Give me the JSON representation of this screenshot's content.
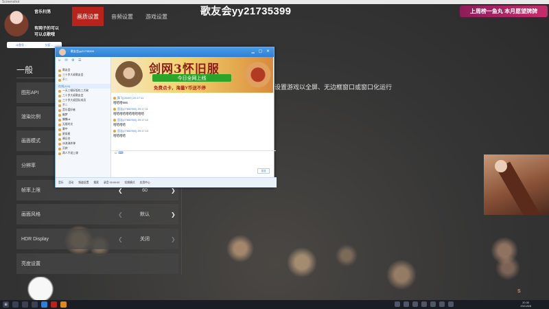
{
  "window": {
    "caption": "Screenshot"
  },
  "streamer": {
    "line1": "音乐扫荡",
    "line2": "有网子的可以",
    "line3": "可以点歌哦",
    "bar_left": "斗鱼号 ...",
    "bar_right": "分区..."
  },
  "tabs": [
    "画质设置",
    "音频设置",
    "游戏设置"
  ],
  "stream_title": "歌友会yy21735399",
  "banner": "上周榜一鱼丸 本月愿望牌牌",
  "section_title": "一般",
  "display_mode_desc": "设置游戏以全屏、无边框窗口或窗口化运行",
  "settings": [
    {
      "label": "图形API",
      "value": ""
    },
    {
      "label": "渲染比例",
      "value": ""
    },
    {
      "label": "画面模式",
      "value": ""
    },
    {
      "label": "分辨率",
      "value": ""
    },
    {
      "label": "帧率上限",
      "value": "60"
    },
    {
      "label": "画面风格",
      "value": "默认"
    },
    {
      "label": "HDR Display",
      "value": "关闭"
    },
    {
      "label": "亮度设置",
      "value": ""
    }
  ],
  "chat": {
    "title": "歌友会yy21735399",
    "sidebar": {
      "icons": "☺ ✉ ⚙ ☰",
      "top_items": [
        "歌友会",
        "三十岁大叔歌友会",
        "不二"
      ],
      "group_header": "在线(124)",
      "members": [
        "一天三顿好饭吃三大碗",
        "三十岁大叔歌友会",
        "三十岁大叔团队成员",
        "不二",
        "音乐爱好者",
        "幽梦",
        "懒懒nll",
        "无限时光",
        "雾中",
        "星辰星",
        "晴日合",
        "冰淇淋炸弹",
        "沉寂",
        "两人不说上课"
      ]
    },
    "ad": {
      "title": "剑网3怀旧服",
      "tagline": "今日全网上线",
      "subline": "免费点卡，海量Y币送不停"
    },
    "messages": [
      {
        "time": "舞飞(28497)  20:17:11",
        "body": "哈哈哈666"
      },
      {
        "time": "思念(27682950)  20:17:11",
        "body": "哈哈哈哈哈哈哈哈哈哈"
      },
      {
        "time": "思念(27682950)  20:17:12",
        "body": "哈哈哈哈"
      },
      {
        "time": "思念(27682950)  20:17:13",
        "body": "哈哈哈哈"
      }
    ],
    "input_tools": "☺ ⌨",
    "send_label": "发送",
    "bottom": [
      "音乐",
      "活动",
      "频道设置",
      "搜索",
      "录音 00:00:00",
      "切换模式",
      "应用中心"
    ]
  },
  "taskbar": {
    "start_icon": "⊞",
    "clock_time": "20:30",
    "clock_date": "2021/8/8"
  },
  "watermark": "S"
}
